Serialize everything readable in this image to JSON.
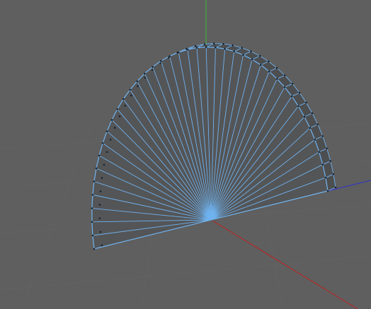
{
  "viewport": {
    "background": "#5f5f5f",
    "grid_color": "#686868",
    "axes": {
      "x_color": "#c02020",
      "y_color": "#3cb83c",
      "z_color": "#3434c8"
    },
    "object": {
      "shape": "half-cylinder fan",
      "segments": 40,
      "face_color": "#545557",
      "side_color": "#4d4e50",
      "edge_color": "#6fb2ee",
      "vertex_color": "#1b2530"
    }
  }
}
